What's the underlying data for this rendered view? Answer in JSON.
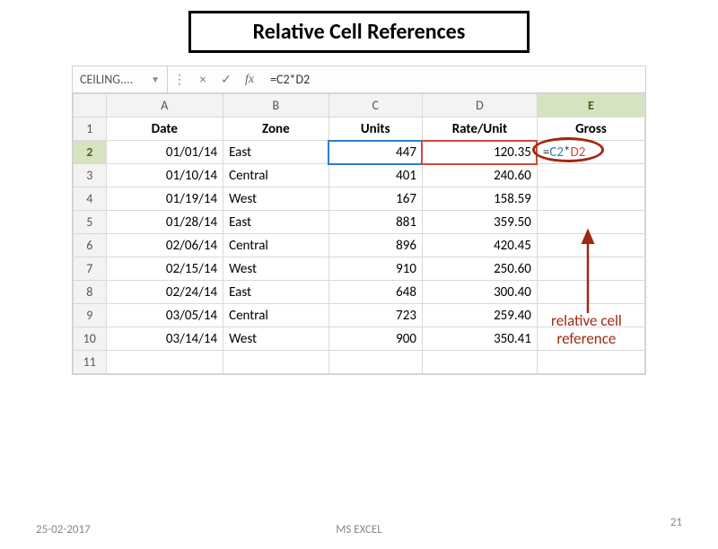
{
  "title": "Relative Cell References",
  "formula_bar": {
    "name_box": "CEILING....",
    "cancel": "×",
    "enter": "✓",
    "fx": "fx",
    "formula": "=C2*D2"
  },
  "columns": [
    "A",
    "B",
    "C",
    "D",
    "E"
  ],
  "header_row": {
    "date": "Date",
    "zone": "Zone",
    "units": "Units",
    "rate": "Rate/Unit",
    "gross": "Gross"
  },
  "rows": [
    {
      "n": "1"
    },
    {
      "n": "2",
      "date": "01/01/14",
      "zone": "East",
      "units": "447",
      "rate": "120.35",
      "gross_prefix": "=",
      "gross_c": "C2",
      "gross_op": "*",
      "gross_d": "D2"
    },
    {
      "n": "3",
      "date": "01/10/14",
      "zone": "Central",
      "units": "401",
      "rate": "240.60"
    },
    {
      "n": "4",
      "date": "01/19/14",
      "zone": "West",
      "units": "167",
      "rate": "158.59"
    },
    {
      "n": "5",
      "date": "01/28/14",
      "zone": "East",
      "units": "881",
      "rate": "359.50"
    },
    {
      "n": "6",
      "date": "02/06/14",
      "zone": "Central",
      "units": "896",
      "rate": "420.45"
    },
    {
      "n": "7",
      "date": "02/15/14",
      "zone": "West",
      "units": "910",
      "rate": "250.60"
    },
    {
      "n": "8",
      "date": "02/24/14",
      "zone": "East",
      "units": "648",
      "rate": "300.40"
    },
    {
      "n": "9",
      "date": "03/05/14",
      "zone": "Central",
      "units": "723",
      "rate": "259.40"
    },
    {
      "n": "10",
      "date": "03/14/14",
      "zone": "West",
      "units": "900",
      "rate": "350.41"
    },
    {
      "n": "11"
    }
  ],
  "annotation": {
    "line1": "relative cell",
    "line2": "reference"
  },
  "footer": {
    "date": "25-02-2017",
    "center": "MS EXCEL",
    "page": "21"
  }
}
